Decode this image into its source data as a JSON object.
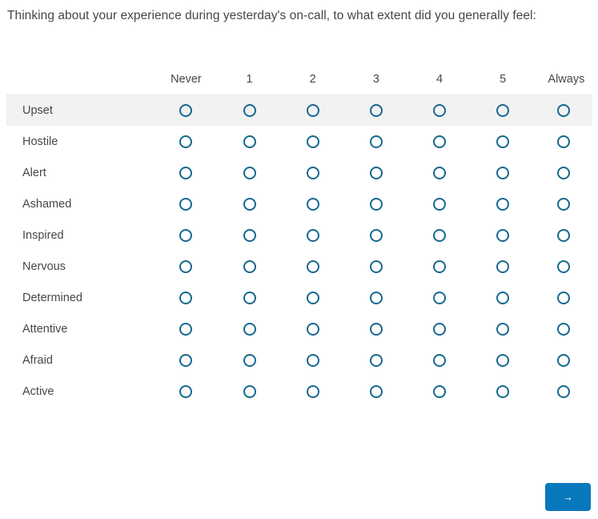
{
  "question": {
    "prompt": "Thinking about your experience during yesterday's on-call, to what extent did you generally feel:"
  },
  "matrix": {
    "label_column_header": "",
    "scale_headers": [
      "Never",
      "1",
      "2",
      "3",
      "4",
      "5",
      "Always"
    ],
    "rows": [
      {
        "label": "Upset",
        "selected": null,
        "striped": true
      },
      {
        "label": "Hostile",
        "selected": null,
        "striped": false
      },
      {
        "label": "Alert",
        "selected": null,
        "striped": false
      },
      {
        "label": "Ashamed",
        "selected": null,
        "striped": false
      },
      {
        "label": "Inspired",
        "selected": null,
        "striped": false
      },
      {
        "label": "Nervous",
        "selected": null,
        "striped": false
      },
      {
        "label": "Determined",
        "selected": null,
        "striped": false
      },
      {
        "label": "Attentive",
        "selected": null,
        "striped": false
      },
      {
        "label": "Afraid",
        "selected": null,
        "striped": false
      },
      {
        "label": "Active",
        "selected": null,
        "striped": false
      }
    ]
  },
  "footer": {
    "next_label": "→"
  },
  "colors": {
    "accent_button": "#0878bd",
    "radio_ring": "#16688f",
    "text": "#44474a",
    "stripe": "#f2f2f2",
    "row_border": "#eceaea",
    "page_background": "#ffffff"
  }
}
